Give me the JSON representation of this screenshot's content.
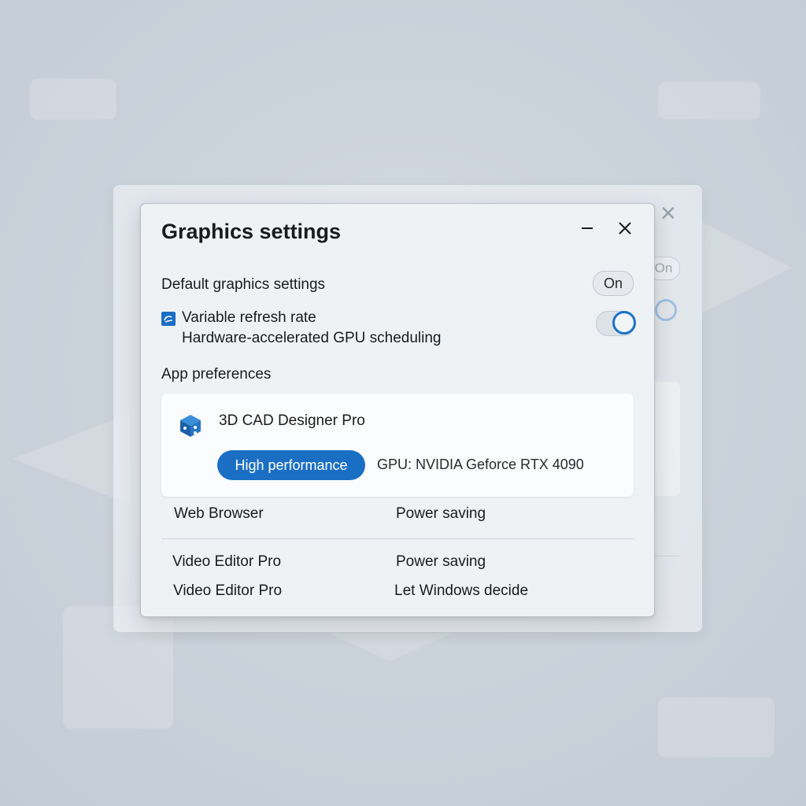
{
  "dialog": {
    "title": "Graphics settings"
  },
  "default_settings": {
    "label": "Default graphics settings",
    "state_label": "On"
  },
  "variable_refresh": {
    "label": "Variable refresh rate",
    "toggle_on": true
  },
  "hags": {
    "label": "Hardware-accelerated GPU scheduling"
  },
  "app_preferences": {
    "heading": "App preferences",
    "selected_app": {
      "name": "3D CAD Designer Pro",
      "preference": "High performance",
      "gpu": "GPU: NVIDIA Geforce RTX 4090"
    },
    "apps": [
      {
        "name": "Web Browser",
        "preference": "Power saving"
      },
      {
        "name": "Video Editor Pro",
        "preference": "Power saving"
      },
      {
        "name": "Video Editor Pro",
        "preference": "Let Windows decide"
      }
    ]
  },
  "colors": {
    "accent": "#1a6fc4",
    "toggle_accent": "#1a73c5",
    "dialog_bg": "#eff2f5",
    "card_bg": "#fbfcfd"
  },
  "icons": {
    "minimize": "minimize-icon",
    "close": "close-icon",
    "refresh": "refresh-rate-icon",
    "app": "cube-app-icon"
  }
}
